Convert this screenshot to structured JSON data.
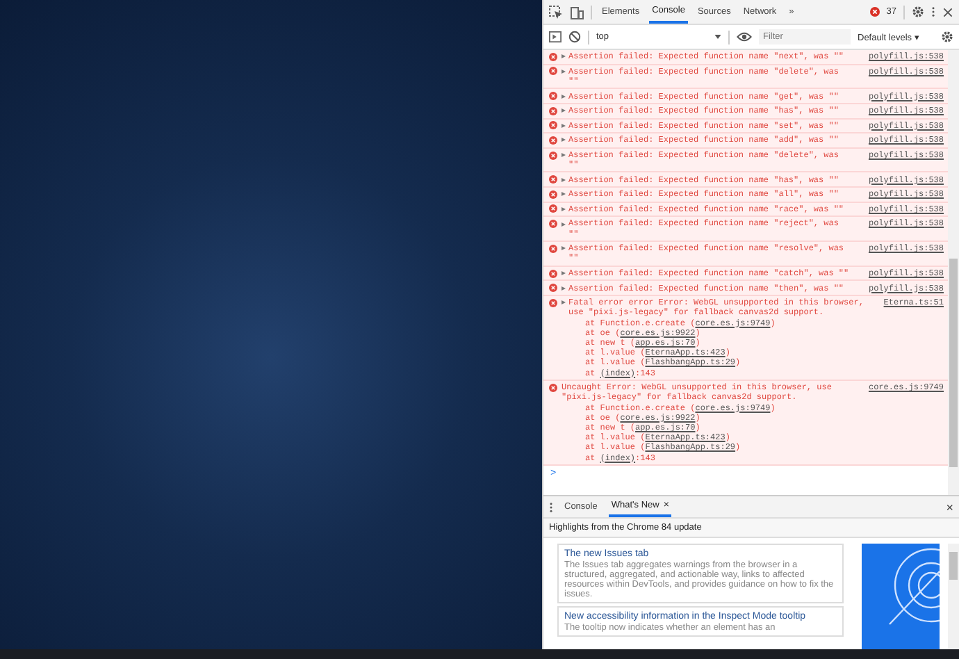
{
  "devtools": {
    "tabs": [
      {
        "label": "Elements",
        "selected": false
      },
      {
        "label": "Console",
        "selected": true
      },
      {
        "label": "Sources",
        "selected": false
      },
      {
        "label": "Network",
        "selected": false
      }
    ],
    "more_tabs": "»",
    "error_count": "37",
    "toolbar": {
      "context": "top",
      "filter": {
        "placeholder": "Filter"
      },
      "levels": "Default levels ▾"
    },
    "messages": [
      {
        "kind": "error",
        "expandable": true,
        "text": "Assertion failed: Expected function name \"next\", was \"\"",
        "source": "polyfill.js:538"
      },
      {
        "kind": "error",
        "expandable": true,
        "text": "Assertion failed: Expected function name \"delete\", was \"\"",
        "source": "polyfill.js:538"
      },
      {
        "kind": "error",
        "expandable": true,
        "text": "Assertion failed: Expected function name \"get\", was \"\"",
        "source": "polyfill.js:538"
      },
      {
        "kind": "error",
        "expandable": true,
        "text": "Assertion failed: Expected function name \"has\", was \"\"",
        "source": "polyfill.js:538"
      },
      {
        "kind": "error",
        "expandable": true,
        "text": "Assertion failed: Expected function name \"set\", was \"\"",
        "source": "polyfill.js:538"
      },
      {
        "kind": "error",
        "expandable": true,
        "text": "Assertion failed: Expected function name \"add\", was \"\"",
        "source": "polyfill.js:538"
      },
      {
        "kind": "error",
        "expandable": true,
        "text": "Assertion failed: Expected function name \"delete\", was \"\"",
        "source": "polyfill.js:538"
      },
      {
        "kind": "error",
        "expandable": true,
        "text": "Assertion failed: Expected function name \"has\", was \"\"",
        "source": "polyfill.js:538"
      },
      {
        "kind": "error",
        "expandable": true,
        "text": "Assertion failed: Expected function name \"all\", was \"\"",
        "source": "polyfill.js:538"
      },
      {
        "kind": "error",
        "expandable": true,
        "text": "Assertion failed: Expected function name \"race\", was \"\"",
        "source": "polyfill.js:538"
      },
      {
        "kind": "error",
        "expandable": true,
        "text": "Assertion failed: Expected function name \"reject\", was \"\"",
        "source": "polyfill.js:538"
      },
      {
        "kind": "error",
        "expandable": true,
        "text": "Assertion failed: Expected function name \"resolve\", was \"\"",
        "source": "polyfill.js:538"
      },
      {
        "kind": "error",
        "expandable": true,
        "text": "Assertion failed: Expected function name \"catch\", was \"\"",
        "source": "polyfill.js:538"
      },
      {
        "kind": "error",
        "expandable": true,
        "text": "Assertion failed: Expected function name \"then\", was \"\"",
        "source": "polyfill.js:538"
      },
      {
        "kind": "error",
        "expandable": true,
        "text": "Fatal error error Error: WebGL unsupported in this browser, use \"pixi.js-legacy\" for fallback canvas2d support.",
        "source": "Eterna.ts:51",
        "stack": [
          {
            "before": "at Function.e.create (",
            "link": "core.es.js:9749",
            "after": ")"
          },
          {
            "before": "at oe (",
            "link": "core.es.js:9922",
            "after": ")"
          },
          {
            "before": "at new t (",
            "link": "app.es.js:70",
            "after": ")"
          },
          {
            "before": "at l.value (",
            "link": "EternaApp.ts:423",
            "after": ")"
          },
          {
            "before": "at l.value (",
            "link": "FlashbangApp.ts:29",
            "after": ")"
          },
          {
            "before": "at ",
            "link": "(index)",
            "after": ":143"
          }
        ]
      },
      {
        "kind": "error",
        "expandable": false,
        "text": "Uncaught Error: WebGL unsupported in this browser, use \"pixi.js-legacy\" for fallback canvas2d support.",
        "source": "core.es.js:9749",
        "stack": [
          {
            "before": "at Function.e.create (",
            "link": "core.es.js:9749",
            "after": ")"
          },
          {
            "before": "at oe (",
            "link": "core.es.js:9922",
            "after": ")"
          },
          {
            "before": "at new t (",
            "link": "app.es.js:70",
            "after": ")"
          },
          {
            "before": "at l.value (",
            "link": "EternaApp.ts:423",
            "after": ")"
          },
          {
            "before": "at l.value (",
            "link": "FlashbangApp.ts:29",
            "after": ")"
          },
          {
            "before": "at ",
            "link": "(index)",
            "after": ":143"
          }
        ]
      }
    ],
    "prompt": ">",
    "drawer": {
      "tabs": [
        {
          "label": "Console",
          "selected": false,
          "closable": false
        },
        {
          "label": "What's New",
          "selected": true,
          "closable": true
        }
      ],
      "close": "×",
      "tab_close": "×",
      "headline": "Highlights from the Chrome 84 update",
      "cards": [
        {
          "title": "The new Issues tab",
          "body": "The Issues tab aggregates warnings from the browser in a structured, aggregated, and actionable way, links to affected resources within DevTools, and provides guidance on how to fix the issues."
        },
        {
          "title": "New accessibility information in the Inspect Mode tooltip",
          "body": "The tooltip now indicates whether an element has an"
        }
      ]
    }
  }
}
